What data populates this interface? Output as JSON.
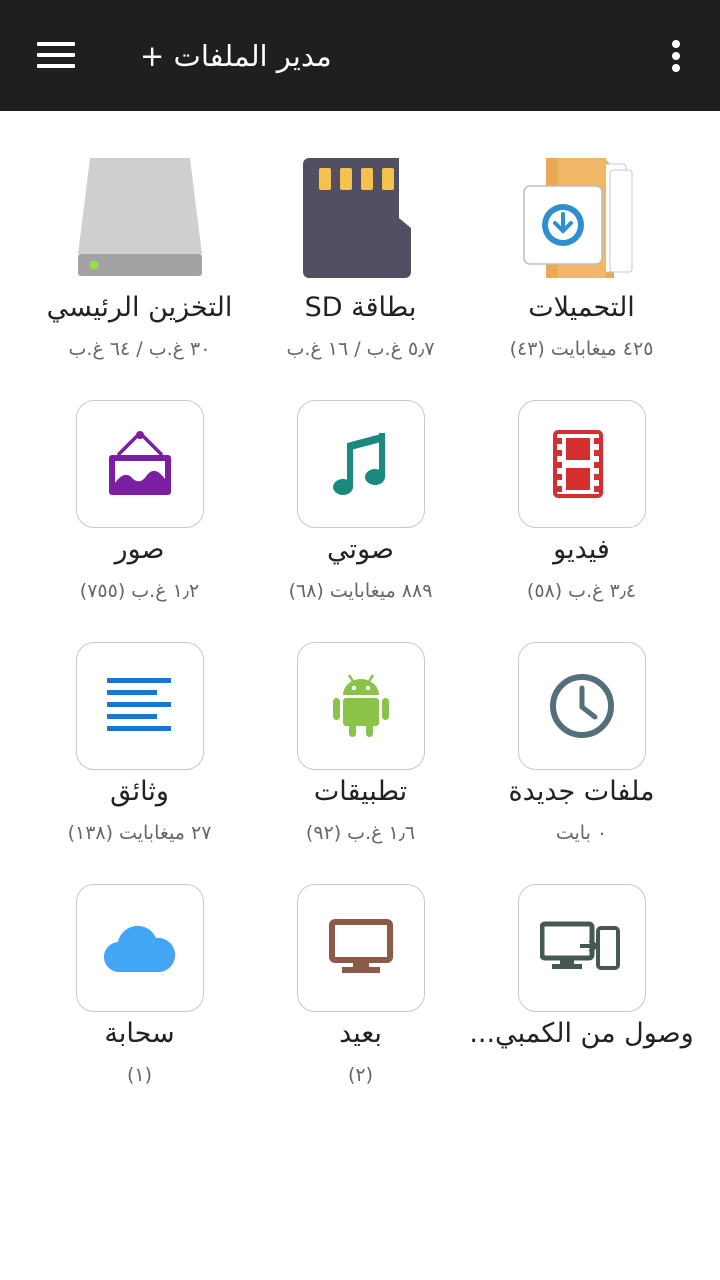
{
  "header": {
    "title": "مدير الملفات +"
  },
  "tiles": [
    {
      "label": "التحميلات",
      "sub": "٤٢٥ ميغابايت (٤٣)",
      "icon": "downloads-folder-icon"
    },
    {
      "label": "بطاقة SD",
      "sub": "٥٫٧ غ.ب / ١٦ غ.ب",
      "icon": "sd-card-icon"
    },
    {
      "label": "التخزين الرئيسي",
      "sub": "٣٠ غ.ب / ٦٤ غ.ب",
      "icon": "hard-drive-icon"
    },
    {
      "label": "فيديو",
      "sub": "٣٫٤ غ.ب (٥٨)",
      "icon": "film-icon",
      "color": "#d32f2f"
    },
    {
      "label": "صوتي",
      "sub": "٨٨٩ ميغابايت (٦٨)",
      "icon": "music-note-icon",
      "color": "#1a8a7e"
    },
    {
      "label": "صور",
      "sub": "١٫٢ غ.ب (٧٥٥)",
      "icon": "picture-frame-icon",
      "color": "#7b1fa2"
    },
    {
      "label": "ملفات جديدة",
      "sub": "٠ بايت",
      "icon": "clock-icon",
      "color": "#546e7a"
    },
    {
      "label": "تطبيقات",
      "sub": "١٫٦ غ.ب (٩٢)",
      "icon": "android-icon",
      "color": "#8bc34a"
    },
    {
      "label": "وثائق",
      "sub": "٢٧ ميغابايت (١٣٨)",
      "icon": "document-lines-icon",
      "color": "#1976d2"
    },
    {
      "label": "وصول من الكمبي...",
      "sub": "",
      "icon": "pc-to-phone-icon",
      "color": "#455a4f"
    },
    {
      "label": "بعيد",
      "sub": "(٢)",
      "icon": "monitor-icon",
      "color": "#8d5a47"
    },
    {
      "label": "سحابة",
      "sub": "(١)",
      "icon": "cloud-icon",
      "color": "#42a5f5"
    }
  ]
}
